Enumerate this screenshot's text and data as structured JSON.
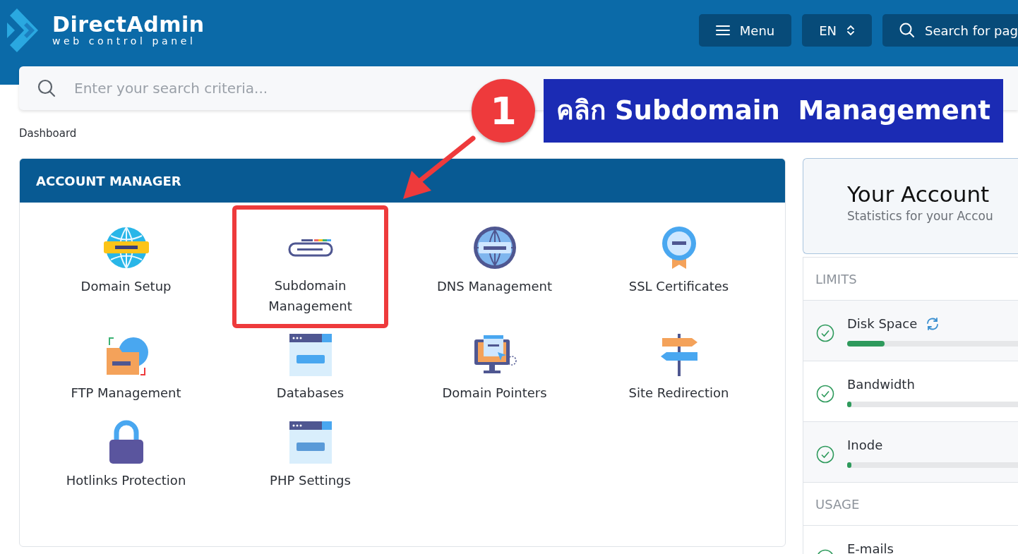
{
  "header": {
    "logo": {
      "name": "DirectAdmin",
      "tagline": "web control panel"
    },
    "buttons": [
      {
        "kind": "menu",
        "label": "Menu"
      },
      {
        "kind": "select",
        "label": "EN"
      },
      {
        "kind": "search",
        "label": "Search for pag"
      }
    ]
  },
  "search": {
    "placeholder": "Enter your search criteria..."
  },
  "breadcrumb": "Dashboard",
  "account_manager": {
    "title": "ACCOUNT MANAGER",
    "items": [
      {
        "label": "Domain Setup",
        "highlighted": false
      },
      {
        "label": "Subdomain Management",
        "highlighted": true
      },
      {
        "label": "DNS Management",
        "highlighted": false
      },
      {
        "label": "SSL Certificates",
        "highlighted": false
      },
      {
        "label": "FTP Management",
        "highlighted": false
      },
      {
        "label": "Databases",
        "highlighted": false
      },
      {
        "label": "Domain Pointers",
        "highlighted": false
      },
      {
        "label": "Site Redirection",
        "highlighted": false
      },
      {
        "label": "Hotlinks Protection",
        "highlighted": false
      },
      {
        "label": "PHP Settings",
        "highlighted": false
      }
    ]
  },
  "your_account": {
    "title": "Your Account",
    "subtitle": "Statistics for your Accou",
    "sections": [
      {
        "title": "LIMITS",
        "items": [
          {
            "label": "Disk Space",
            "refresh": true,
            "level": 0.22
          },
          {
            "label": "Bandwidth",
            "refresh": false,
            "level": 0.01
          },
          {
            "label": "Inode",
            "refresh": false,
            "level": 0.01
          }
        ]
      },
      {
        "title": "USAGE",
        "items": [
          {
            "label": "E-mails",
            "refresh": false
          }
        ]
      }
    ]
  },
  "annotation": {
    "number": "1",
    "text": "คลิก Subdomain  Management"
  }
}
